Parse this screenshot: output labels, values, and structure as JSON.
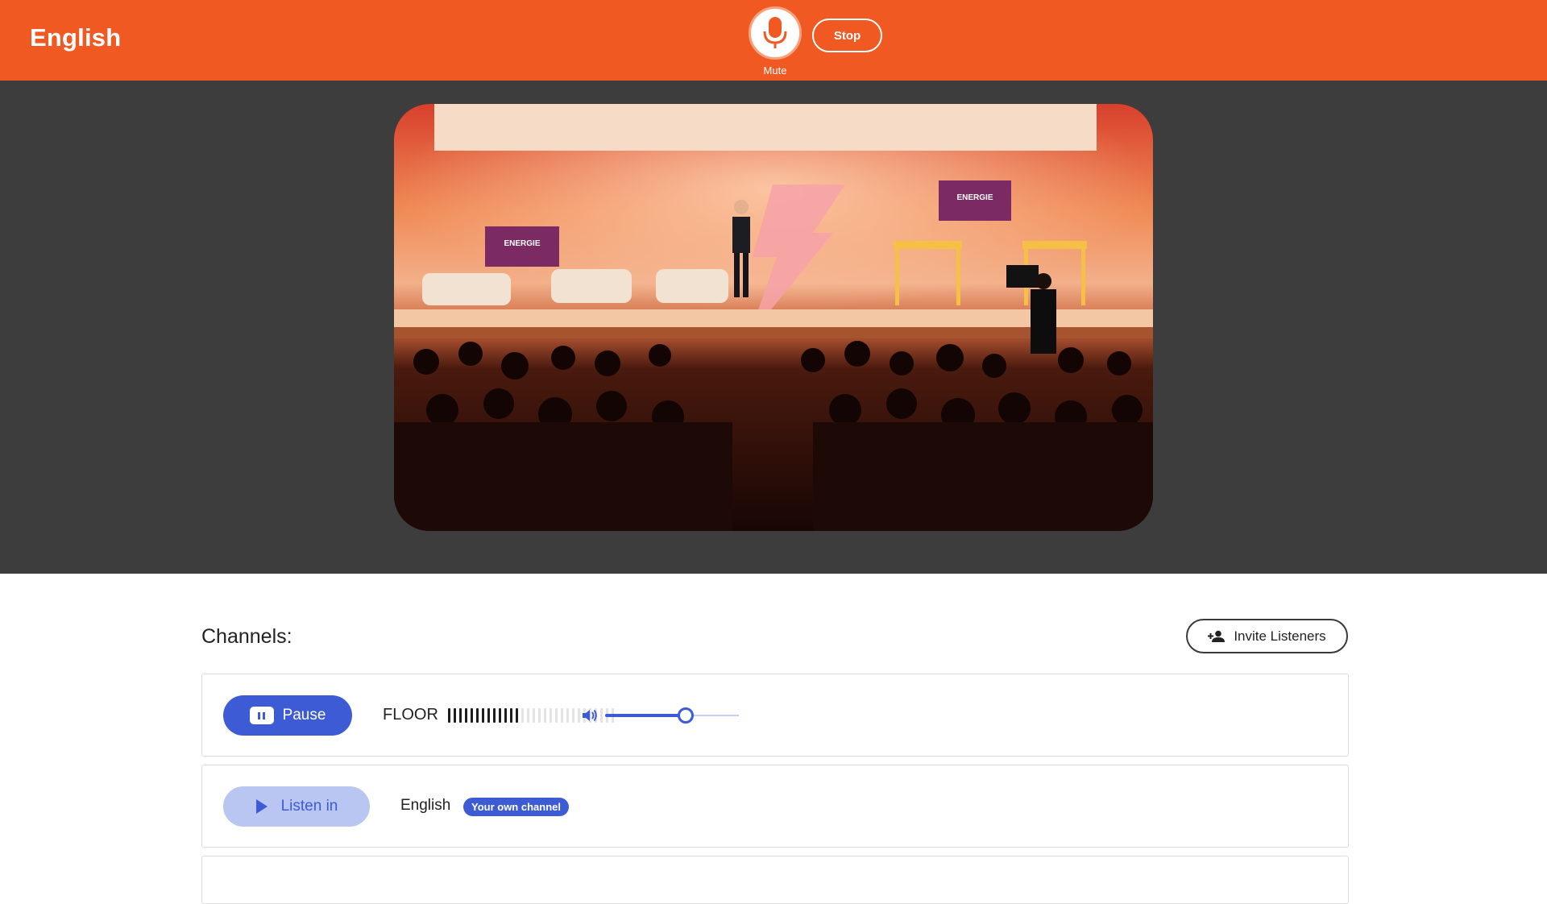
{
  "header": {
    "title": "English",
    "mute_label": "Mute",
    "stop_label": "Stop",
    "accent_color": "#f05a22"
  },
  "video": {
    "stage_screen_brand": "ENERGIE"
  },
  "channels": {
    "title": "Channels:",
    "invite_label": "Invite Listeners",
    "floor": {
      "button_label": "Pause",
      "name": "FLOOR",
      "level_bars_total": 30,
      "level_bars_active": 13,
      "volume_fraction": 0.6
    },
    "english": {
      "button_label": "Listen in",
      "name": "English",
      "badge": "Your own channel"
    },
    "primary_color": "#3d5bd4"
  }
}
